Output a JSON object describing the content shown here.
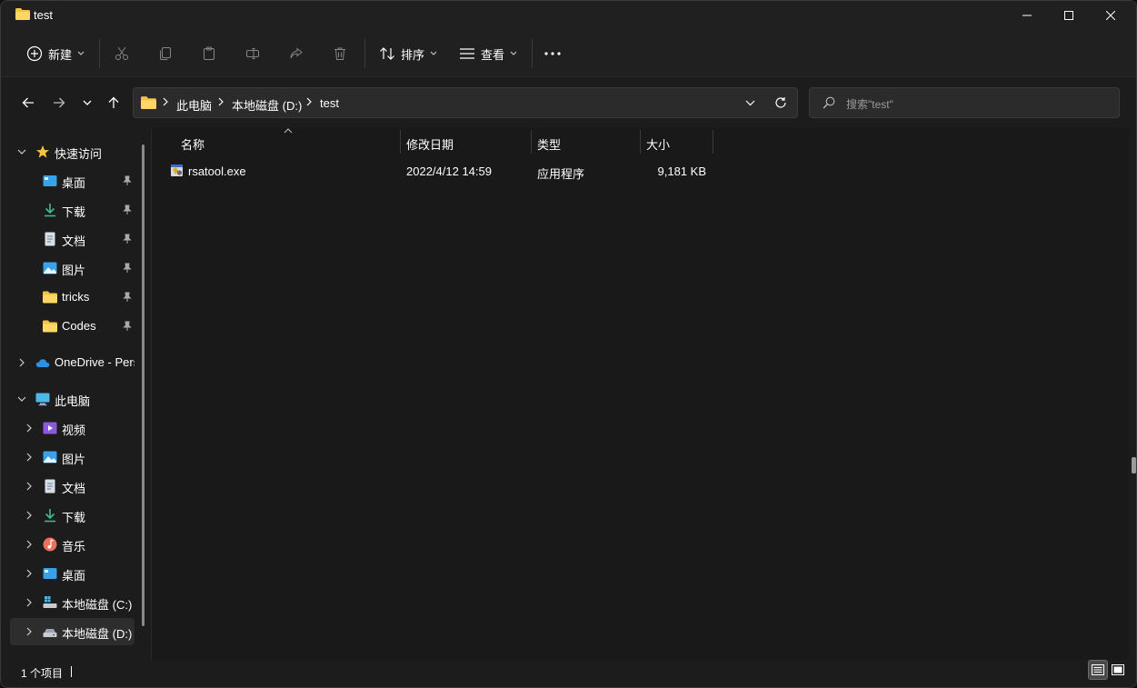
{
  "window": {
    "title": "test"
  },
  "toolbar": {
    "new_label": "新建",
    "sort_label": "排序",
    "view_label": "查看"
  },
  "address": {
    "crumbs": [
      "此电脑",
      "本地磁盘 (D:)",
      "test"
    ],
    "search_placeholder": "搜索\"test\""
  },
  "sidebar": {
    "quick_access": "快速访问",
    "pinned": [
      {
        "label": "桌面"
      },
      {
        "label": "下载"
      },
      {
        "label": "文档"
      },
      {
        "label": "图片"
      },
      {
        "label": "tricks"
      },
      {
        "label": "Codes"
      }
    ],
    "onedrive": "OneDrive - Pers",
    "this_pc": "此电脑",
    "pc_items": [
      {
        "label": "视频"
      },
      {
        "label": "图片"
      },
      {
        "label": "文档"
      },
      {
        "label": "下载"
      },
      {
        "label": "音乐"
      },
      {
        "label": "桌面"
      },
      {
        "label": "本地磁盘 (C:)"
      },
      {
        "label": "本地磁盘 (D:)"
      }
    ]
  },
  "columns": {
    "name": "名称",
    "modified": "修改日期",
    "type": "类型",
    "size": "大小"
  },
  "files": [
    {
      "name": "rsatool.exe",
      "modified": "2022/4/12 14:59",
      "type": "应用程序",
      "size": "9,181 KB"
    }
  ],
  "status": {
    "count": "1 个项目"
  },
  "colors": {
    "folder": "#f5c242",
    "accent": "#4cc2ff",
    "background": "#1c1c1c"
  }
}
